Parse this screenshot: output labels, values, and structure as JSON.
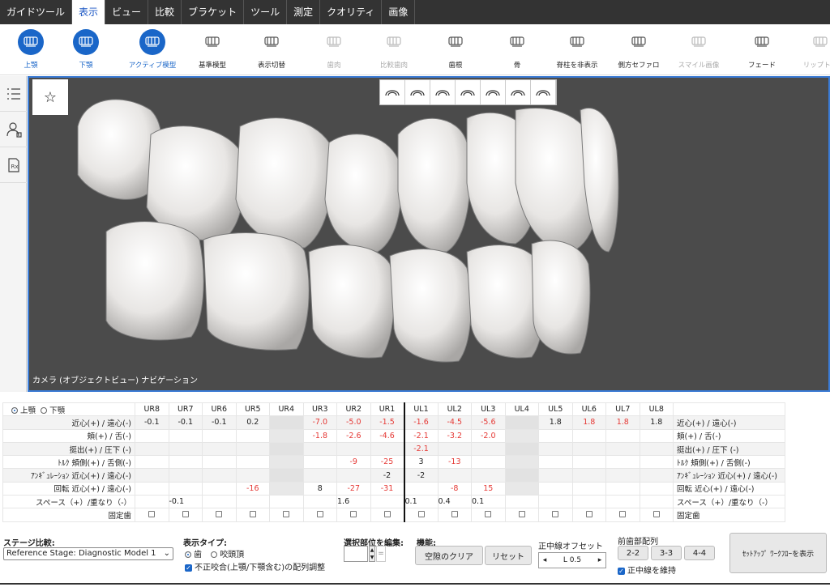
{
  "menu": [
    "ガイドツール",
    "表示",
    "ビュー",
    "比較",
    "ブラケット",
    "ツール",
    "測定",
    "クオリティ",
    "画像"
  ],
  "menu_active": 1,
  "toolbar": [
    {
      "label": "上顎",
      "state": "on",
      "icon": "upper-jaw-icon"
    },
    {
      "label": "下顎",
      "state": "on",
      "icon": "lower-jaw-icon"
    },
    {
      "label": "アクティブ模型",
      "state": "on",
      "icon": "active-model-icon"
    },
    {
      "label": "基準模型",
      "state": "normal",
      "icon": "reference-model-icon"
    },
    {
      "label": "表示切替",
      "state": "normal",
      "icon": "toggle-display-icon"
    },
    {
      "label": "歯肉",
      "state": "disabled",
      "icon": "gingiva-icon"
    },
    {
      "label": "比較歯肉",
      "state": "disabled",
      "icon": "compare-gingiva-icon"
    },
    {
      "label": "歯根",
      "state": "normal",
      "icon": "tooth-root-icon"
    },
    {
      "label": "骨",
      "state": "normal",
      "icon": "bone-icon"
    },
    {
      "label": "脊柱を非表示",
      "state": "normal",
      "icon": "hide-spine-icon"
    },
    {
      "label": "側方セファロ",
      "state": "normal",
      "icon": "lateral-ceph-icon"
    },
    {
      "label": "スマイル画像",
      "state": "disabled",
      "icon": "smile-image-icon"
    },
    {
      "label": "フェード",
      "state": "normal",
      "icon": "fade-icon"
    },
    {
      "label": "リップトレ",
      "state": "disabled",
      "icon": "lip-trace-icon"
    }
  ],
  "viewport": {
    "caption": "カメラ (オブジェクトビュー) ナビゲーション",
    "star": "☆"
  },
  "table": {
    "jaw_upper": "上顎",
    "jaw_lower": "下顎",
    "teeth": [
      "UR8",
      "UR7",
      "UR6",
      "UR5",
      "UR4",
      "UR3",
      "UR2",
      "UR1",
      "UL1",
      "UL2",
      "UL3",
      "UL4",
      "UL5",
      "UL6",
      "UL7",
      "UL8"
    ],
    "rows": [
      {
        "left": "近心(+) / 遠心(-)",
        "right": "近心(+) / 遠心(-)",
        "values": [
          "-0.1",
          "-0.1",
          "-0.1",
          "0.2",
          "",
          "-7.0",
          "-5.0",
          "-1.5",
          "-1.6",
          "-4.5",
          "-5.6",
          "",
          "1.8",
          "1.8",
          "1.8",
          "1.8"
        ]
      },
      {
        "left": "頬(+) / 舌(-)",
        "right": "頬(+) / 舌(-)",
        "values": [
          "",
          "",
          "",
          "",
          "",
          "-1.8",
          "-2.6",
          "-4.6",
          "-2.1",
          "-3.2",
          "-2.0",
          "",
          "",
          "",
          "",
          ""
        ]
      },
      {
        "left": "挺出(+) / 圧下 (-)",
        "right": "挺出(+) / 圧下 (-)",
        "values": [
          "",
          "",
          "",
          "",
          "",
          "",
          "",
          "",
          "-2.1",
          "",
          "",
          "",
          "",
          "",
          "",
          ""
        ]
      },
      {
        "left": "ﾄﾙｸ 頬側(+) / 舌側(-)",
        "right": "ﾄﾙｸ 頬側(+) / 舌側(-)",
        "values": [
          "",
          "",
          "",
          "",
          "",
          "",
          "-9",
          "-25",
          "3",
          "-13",
          "",
          "",
          "",
          "",
          "",
          ""
        ]
      },
      {
        "left": "ｱﾝｷﾞｭﾚｰｼｮﾝ 近心(+) / 遠心(-)",
        "right": "ｱﾝｷﾞｭﾚｰｼｮﾝ 近心(+) / 遠心(-)",
        "values": [
          "",
          "",
          "",
          "",
          "",
          "",
          "",
          "-2",
          "-2",
          "",
          "",
          "",
          "",
          "",
          "",
          ""
        ]
      },
      {
        "left": "回転 近心(+) / 遠心(-)",
        "right": "回転 近心(+) / 遠心(-)",
        "values": [
          "",
          "",
          "",
          "-16",
          "",
          "8",
          "-27",
          "-31",
          "",
          "-8",
          "15",
          "",
          "",
          "",
          "",
          ""
        ]
      }
    ],
    "red_cells": [
      [
        0,
        5
      ],
      [
        0,
        6
      ],
      [
        0,
        7
      ],
      [
        0,
        8
      ],
      [
        0,
        9
      ],
      [
        0,
        10
      ],
      [
        0,
        13
      ],
      [
        0,
        14
      ],
      [
        1,
        5
      ],
      [
        1,
        6
      ],
      [
        1,
        7
      ],
      [
        1,
        8
      ],
      [
        1,
        9
      ],
      [
        1,
        10
      ],
      [
        2,
        8
      ],
      [
        3,
        6
      ],
      [
        3,
        7
      ],
      [
        3,
        9
      ],
      [
        5,
        3
      ],
      [
        5,
        6
      ],
      [
        5,
        7
      ],
      [
        5,
        9
      ],
      [
        5,
        10
      ]
    ],
    "space_label": "スペース（+）/重なり（-）",
    "space_values": [
      "-0.1",
      "1.6",
      "0.1",
      "0.4",
      "0.1"
    ],
    "fixed_label": "固定歯"
  },
  "bottom": {
    "stage_label": "ステージ比較:",
    "stage_select": "Reference Stage: Diagnostic Model 1",
    "display_type_label": "表示タイプ:",
    "display_tooth": "歯",
    "display_cusp": "咬頭頂",
    "malocclusion_check": "不正咬合(上顎/下顎含む)の配列調整",
    "edit_label": "選択部位を編集:",
    "edit_value": "",
    "edit_unit": "=",
    "function_label": "機能:",
    "clear_space": "空隙のクリア",
    "reset": "リセット",
    "midline_label": "正中線オフセット",
    "midline_value": "L 0.5",
    "anterior_label": "前歯部配列",
    "a22": "2-2",
    "a33": "3-3",
    "a44": "4-4",
    "keep_midline": "正中線を維持",
    "setup_workflow": "ｾｯﾄｱｯﾌﾟ ﾜｰｸﾌﾛｰを表示"
  }
}
